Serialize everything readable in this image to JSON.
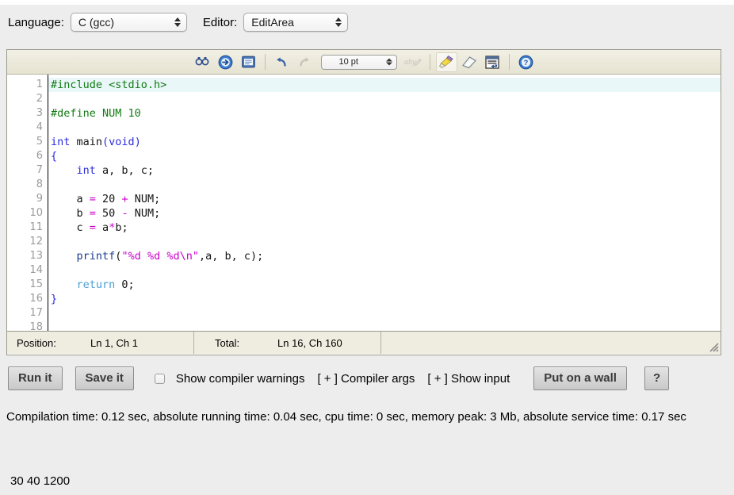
{
  "header": {
    "language_label": "Language:",
    "language_value": "C (gcc)",
    "editor_label": "Editor:",
    "editor_value": "EditArea"
  },
  "toolbar": {
    "font_size_value": "10 pt",
    "icons": [
      {
        "name": "search-icon",
        "title": "Search"
      },
      {
        "name": "go-to-line-icon",
        "title": "Go to line"
      },
      {
        "name": "toggle-editor-icon",
        "title": "Toggle editor"
      },
      {
        "name": "undo-icon",
        "title": "Undo"
      },
      {
        "name": "redo-icon",
        "title": "Redo"
      },
      {
        "name": "spellcheck-icon",
        "title": "Spell check"
      },
      {
        "name": "syntax-highlight-icon",
        "title": "Syntax highlighting"
      },
      {
        "name": "reset-highlight-icon",
        "title": "Reset highlighting"
      },
      {
        "name": "word-wrap-icon",
        "title": "Word wrap"
      },
      {
        "name": "help-icon",
        "title": "Help"
      }
    ]
  },
  "editor": {
    "line_numbers": [
      "1",
      "2",
      "3",
      "4",
      "5",
      "6",
      "7",
      "8",
      "9",
      "10",
      "11",
      "12",
      "13",
      "14",
      "15",
      "16",
      "17",
      "18"
    ],
    "current_line": 1,
    "code_lines": [
      [
        {
          "t": "#include <stdio.h>",
          "c": "k-pre"
        }
      ],
      [],
      [
        {
          "t": "#define NUM 10",
          "c": "k-pre"
        }
      ],
      [],
      [
        {
          "t": "int ",
          "c": "k-type"
        },
        {
          "t": "main",
          "c": "k-fn"
        },
        {
          "t": "(",
          "c": "k-punct"
        },
        {
          "t": "void",
          "c": "k-type"
        },
        {
          "t": ")",
          "c": "k-punct"
        }
      ],
      [
        {
          "t": "{",
          "c": "k-punct"
        }
      ],
      [
        {
          "t": "    ",
          "c": "k-plain"
        },
        {
          "t": "int",
          "c": "k-type"
        },
        {
          "t": " a, b, c;",
          "c": "k-plain"
        }
      ],
      [],
      [
        {
          "t": "    a ",
          "c": "k-plain"
        },
        {
          "t": "=",
          "c": "k-op"
        },
        {
          "t": " 20 ",
          "c": "k-plain"
        },
        {
          "t": "+",
          "c": "k-op"
        },
        {
          "t": " NUM;",
          "c": "k-plain"
        }
      ],
      [
        {
          "t": "    b ",
          "c": "k-plain"
        },
        {
          "t": "=",
          "c": "k-op"
        },
        {
          "t": " 50 ",
          "c": "k-plain"
        },
        {
          "t": "-",
          "c": "k-op"
        },
        {
          "t": " NUM;",
          "c": "k-plain"
        }
      ],
      [
        {
          "t": "    c ",
          "c": "k-plain"
        },
        {
          "t": "=",
          "c": "k-op"
        },
        {
          "t": " a",
          "c": "k-plain"
        },
        {
          "t": "*",
          "c": "k-op"
        },
        {
          "t": "b;",
          "c": "k-plain"
        }
      ],
      [],
      [
        {
          "t": "    ",
          "c": "k-plain"
        },
        {
          "t": "printf",
          "c": "k-call"
        },
        {
          "t": "(",
          "c": "k-plain"
        },
        {
          "t": "\"%d %d %d\\n\"",
          "c": "k-str"
        },
        {
          "t": ",a, b, c);",
          "c": "k-plain"
        }
      ],
      [],
      [
        {
          "t": "    ",
          "c": "k-plain"
        },
        {
          "t": "return",
          "c": "k-ret"
        },
        {
          "t": " 0;",
          "c": "k-plain"
        }
      ],
      [
        {
          "t": "}",
          "c": "k-punct"
        }
      ],
      [],
      []
    ]
  },
  "status": {
    "position_label": "Position:",
    "position_value": "Ln 1, Ch 1",
    "total_label": "Total:",
    "total_value": "Ln 16, Ch 160"
  },
  "actions": {
    "run_label": "Run it",
    "save_label": "Save it",
    "show_warnings_label": "Show compiler warnings",
    "show_warnings_checked": false,
    "compiler_args_label": "[ + ] Compiler args",
    "show_input_label": "[ + ] Show input",
    "put_on_wall_label": "Put on a wall",
    "help_label": "?"
  },
  "results": {
    "compile_info": "Compilation time: 0.12 sec, absolute running time: 0.04 sec, cpu time: 0 sec, memory peak: 3 Mb, absolute service time: 0.17 sec",
    "program_output": "30 40 1200"
  },
  "colors": {
    "page_bg": "#ededed",
    "toolbar_bg": "#ece9d8",
    "status_bg": "#efece0",
    "current_line_highlight": "#e9f7f8",
    "preprocessor": "#127a12",
    "type_keyword": "#2b2bdd",
    "operator": "#cc00cc",
    "string": "#cc00cc",
    "return_keyword": "#4b9fd5",
    "function_call": "#1a3a8f"
  }
}
